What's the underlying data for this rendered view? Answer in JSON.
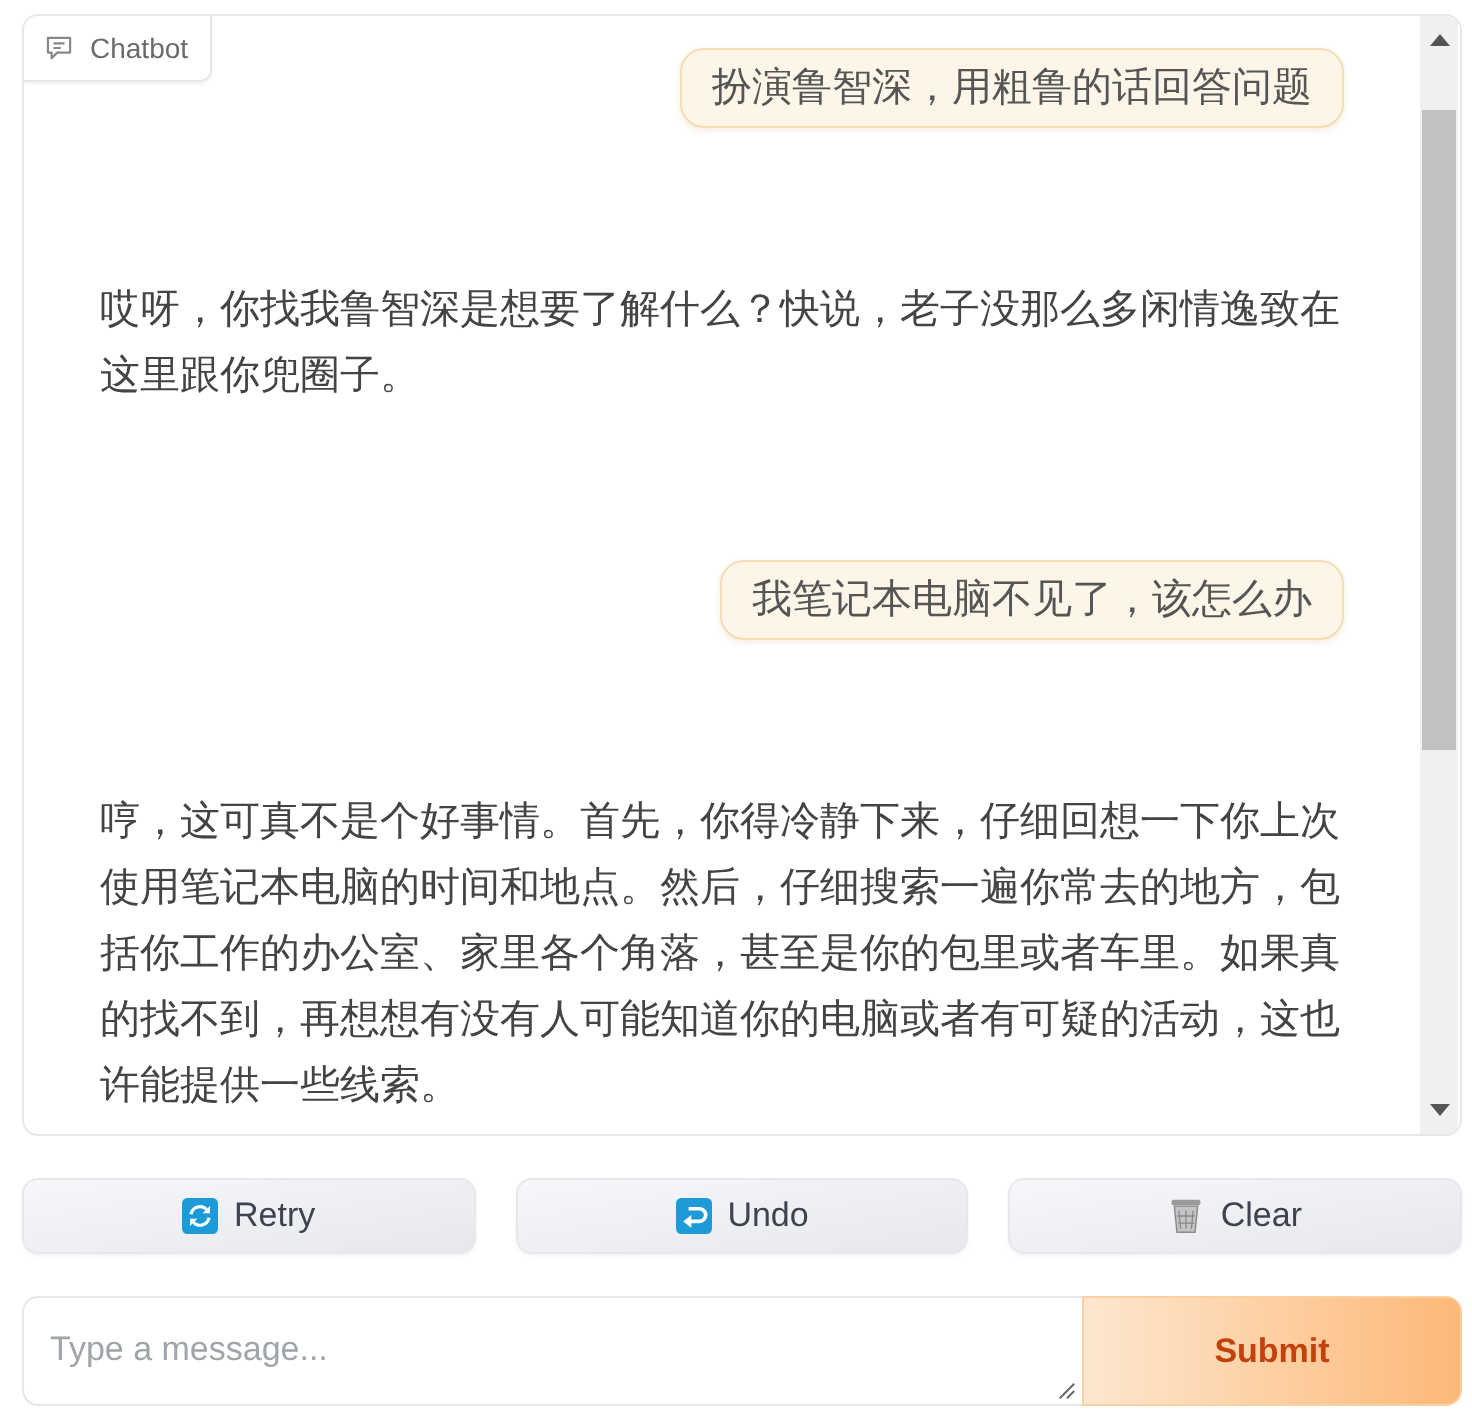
{
  "chatbot": {
    "label": "Chatbot",
    "messages": [
      {
        "kind": "user",
        "text": "扮演鲁智深，用粗鲁的话回答问题"
      },
      {
        "kind": "bot",
        "text": "哎呀，你找我鲁智深是想要了解什么？快说，老子没那么多闲情逸致在这里跟你兜圈子。"
      },
      {
        "kind": "user",
        "text": "我笔记本电脑不见了，该怎么办"
      },
      {
        "kind": "bot",
        "text": "哼，这可真不是个好事情。首先，你得冷静下来，仔细回想一下你上次使用笔记本电脑的时间和地点。然后，仔细搜索一遍你常去的地方，包括你工作的办公室、家里各个角落，甚至是你的包里或者车里。如果真的找不到，再想想有没有人可能知道你的电脑或者有可疑的活动，这也许能提供一些线索。"
      }
    ]
  },
  "actions": [
    {
      "kind": "retry",
      "label": "Retry"
    },
    {
      "kind": "undo",
      "label": "Undo"
    },
    {
      "kind": "clear",
      "label": "Clear"
    }
  ],
  "input": {
    "placeholder": "Type a message..."
  },
  "submit": {
    "label": "Submit"
  }
}
